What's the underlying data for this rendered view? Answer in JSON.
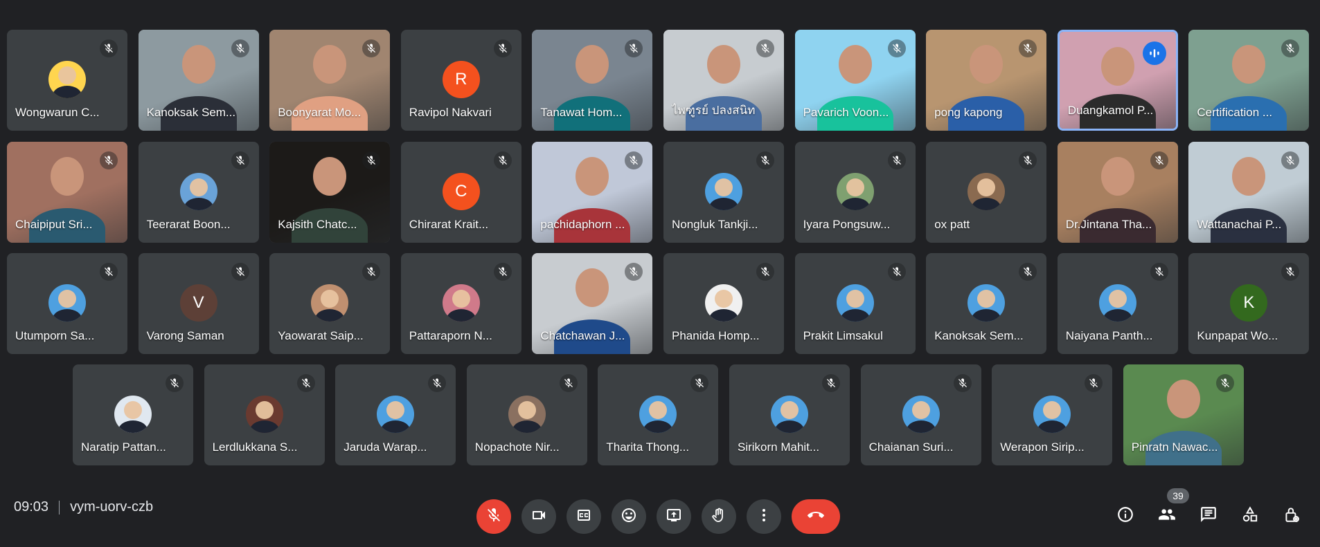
{
  "participants": [
    {
      "name": "Wongwarun C...",
      "type": "avatar-photo",
      "bg": "#ffd54f"
    },
    {
      "name": "Kanoksak Sem...",
      "type": "video",
      "bg": "#8d9aa0",
      "shirt": "#2b2f38"
    },
    {
      "name": "Boonyarat Mo...",
      "type": "video",
      "bg": "#a08570",
      "shirt": "#e0a082"
    },
    {
      "name": "Ravipol Nakvari",
      "type": "initial",
      "initial": "R",
      "bg": "#f4511e"
    },
    {
      "name": "Tanawat Hom...",
      "type": "video",
      "bg": "#7a8590",
      "shirt": "#11707a"
    },
    {
      "name": "ไพฑูรย์ ปลงสนิท",
      "type": "video",
      "bg": "#c7ccd0",
      "shirt": "#4a6ea0"
    },
    {
      "name": "Pavarich Voon...",
      "type": "video",
      "bg": "#8fd3f0",
      "shirt": "#18c29c"
    },
    {
      "name": "pong kapong",
      "type": "video",
      "bg": "#b89570",
      "shirt": "#2a5fa8"
    },
    {
      "name": "Duangkamol P...",
      "type": "video",
      "bg": "#d0a0b0",
      "shirt": "#2b2b2b",
      "speaking": true
    },
    {
      "name": "Certification ...",
      "type": "video",
      "bg": "#7ea090",
      "shirt": "#2a6fb0"
    },
    {
      "name": "Chaipiput Sri...",
      "type": "video",
      "bg": "#a07060",
      "shirt": "#2a5a70"
    },
    {
      "name": "Teerarat Boon...",
      "type": "avatar-photo",
      "bg": "#6aa3d8"
    },
    {
      "name": "Kajsith Chatc...",
      "type": "video",
      "bg": "#1c1a18",
      "shirt": "#31433a"
    },
    {
      "name": "Chirarat Krait...",
      "type": "initial",
      "initial": "C",
      "bg": "#f4511e"
    },
    {
      "name": "pachidaphorn ...",
      "type": "video",
      "bg": "#c0c8d8",
      "shirt": "#a8343a"
    },
    {
      "name": "Nongluk Tankji...",
      "type": "avatar-photo",
      "bg": "#4ea0e0"
    },
    {
      "name": "Iyara Pongsuw...",
      "type": "avatar-photo",
      "bg": "#7fa070"
    },
    {
      "name": "ox patt",
      "type": "avatar-photo",
      "bg": "#8a6a50"
    },
    {
      "name": "Dr.Jintana Tha...",
      "type": "video",
      "bg": "#a88060",
      "shirt": "#3a2a30"
    },
    {
      "name": "Wattanachai P...",
      "type": "video",
      "bg": "#c0ccd4",
      "shirt": "#2a3040"
    },
    {
      "name": "Utumporn Sa...",
      "type": "avatar-photo",
      "bg": "#4ea0e0"
    },
    {
      "name": "Varong Saman",
      "type": "initial",
      "initial": "V",
      "bg": "#5d4037"
    },
    {
      "name": "Yaowarat Saip...",
      "type": "avatar-photo",
      "bg": "#c09070"
    },
    {
      "name": "Pattaraporn N...",
      "type": "avatar-photo",
      "bg": "#d07a8a"
    },
    {
      "name": "Chatchawan J...",
      "type": "video",
      "bg": "#c8ccd0",
      "shirt": "#1f4a8a"
    },
    {
      "name": "Phanida Homp...",
      "type": "avatar-photo",
      "bg": "#f0f0f0"
    },
    {
      "name": "Prakit Limsakul",
      "type": "avatar-photo",
      "bg": "#4ea0e0"
    },
    {
      "name": "Kanoksak Sem...",
      "type": "avatar-photo",
      "bg": "#4ea0e0"
    },
    {
      "name": "Naiyana Panth...",
      "type": "avatar-photo",
      "bg": "#4ea0e0"
    },
    {
      "name": "Kunpapat Wo...",
      "type": "initial",
      "initial": "K",
      "bg": "#33691e"
    },
    {
      "name": "Naratip Pattan...",
      "type": "avatar-photo",
      "bg": "#e0e8f0"
    },
    {
      "name": "Lerdlukkana S...",
      "type": "avatar-photo",
      "bg": "#6a3a30"
    },
    {
      "name": "Jaruda Warap...",
      "type": "avatar-photo",
      "bg": "#4ea0e0"
    },
    {
      "name": "Nopachote Nir...",
      "type": "avatar-photo",
      "bg": "#8a7060"
    },
    {
      "name": "Tharita Thong...",
      "type": "avatar-photo",
      "bg": "#4ea0e0"
    },
    {
      "name": "Sirikorn Mahit...",
      "type": "avatar-photo",
      "bg": "#4ea0e0"
    },
    {
      "name": "Chaianan Suri...",
      "type": "avatar-photo",
      "bg": "#4ea0e0"
    },
    {
      "name": "Werapon Sirip...",
      "type": "avatar-photo",
      "bg": "#4ea0e0"
    },
    {
      "name": "Pinratn Nawac...",
      "type": "video",
      "bg": "#5a8a50",
      "shirt": "#40708a"
    }
  ],
  "meeting": {
    "time": "09:03",
    "code": "vym-uorv-czb"
  },
  "controls": [
    {
      "icon": "mic-off-icon",
      "label": "microphone-off"
    },
    {
      "icon": "videocam-icon",
      "label": "camera"
    },
    {
      "icon": "captions-icon",
      "label": "captions"
    },
    {
      "icon": "emoji-icon",
      "label": "reactions"
    },
    {
      "icon": "present-icon",
      "label": "present"
    },
    {
      "icon": "hand-icon",
      "label": "raise-hand"
    },
    {
      "icon": "more-vert-icon",
      "label": "more-options"
    },
    {
      "icon": "call-end-icon",
      "label": "leave-call"
    }
  ],
  "right_controls": [
    {
      "icon": "info-icon"
    },
    {
      "icon": "people-icon"
    },
    {
      "icon": "chat-icon"
    },
    {
      "icon": "activities-icon"
    },
    {
      "icon": "host-controls-icon"
    }
  ],
  "people_count": "39",
  "colors": {
    "background": "#202124",
    "tile": "#3c4043",
    "end_call": "#ea4335",
    "speaking_border": "#8ab4f8"
  }
}
